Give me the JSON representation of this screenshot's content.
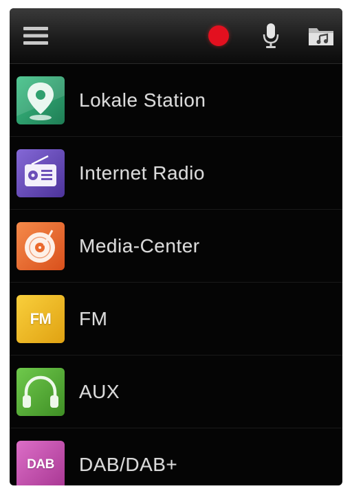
{
  "toolbar": {
    "menu_icon": "hamburger-menu-icon",
    "record_icon": "record-dot-icon",
    "record_color": "#e3101f",
    "mic_icon": "microphone-icon",
    "folder_icon": "music-folder-icon"
  },
  "sources": [
    {
      "label": "Lokale Station",
      "icon": "location-pin-icon",
      "color": "#2fa06e"
    },
    {
      "label": "Internet Radio",
      "icon": "radio-icon",
      "color": "#6b4fb8"
    },
    {
      "label": "Media-Center",
      "icon": "vinyl-disc-icon",
      "color": "#ea6a2e"
    },
    {
      "label": "FM",
      "icon": "fm-icon",
      "icon_text": "FM",
      "color": "#f0b820"
    },
    {
      "label": "AUX",
      "icon": "headphones-icon",
      "color": "#58b23a"
    },
    {
      "label": "DAB/DAB+",
      "icon": "dab-icon",
      "icon_text": "DAB",
      "color": "#c94fb0"
    }
  ]
}
